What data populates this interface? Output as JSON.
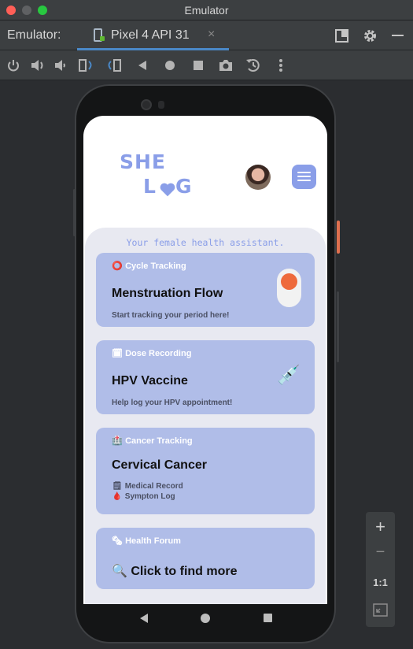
{
  "window": {
    "title": "Emulator"
  },
  "tabbar": {
    "label": "Emulator:",
    "device_tab": "Pixel 4 API 31",
    "close": "×"
  },
  "toolbar": {
    "icons": [
      "power-icon",
      "volume-up-icon",
      "volume-down-icon",
      "rotate-left-icon",
      "rotate-right-icon",
      "back-icon",
      "home-icon",
      "overview-icon",
      "camera-icon",
      "snapshot-icon",
      "more-icon"
    ]
  },
  "app": {
    "logo_line1": "SHE",
    "logo_l": "L",
    "logo_g": "G",
    "tagline": "Your female health assistant.",
    "cards": [
      {
        "category_icon": "⭕",
        "category": "Cycle Tracking",
        "title": "Menstruation Flow",
        "subtitle": "Start tracking your period here!"
      },
      {
        "category_icon": "🗓",
        "category": "Dose Recording",
        "title": "HPV Vaccine",
        "subtitle": "Help log your HPV appointment!",
        "side_icon": "💉"
      },
      {
        "category_icon": "🏥",
        "category": "Cancer Tracking",
        "title": "Cervical Cancer",
        "links": [
          {
            "icon": "🗒",
            "label": "Medical Record"
          },
          {
            "icon": "🩸",
            "label": "Sympton Log"
          }
        ]
      },
      {
        "category_icon": "🗞",
        "category": "Health Forum",
        "title_icon": "🔍",
        "title": "Click to find more"
      }
    ]
  },
  "zoom": {
    "plus": "+",
    "minus": "−",
    "ratio": "1:1"
  },
  "colors": {
    "accent": "#8a9ee8",
    "card": "#b0bde8",
    "toggle_knob": "#ee6a3c",
    "tab_underline": "#4a88c7"
  }
}
